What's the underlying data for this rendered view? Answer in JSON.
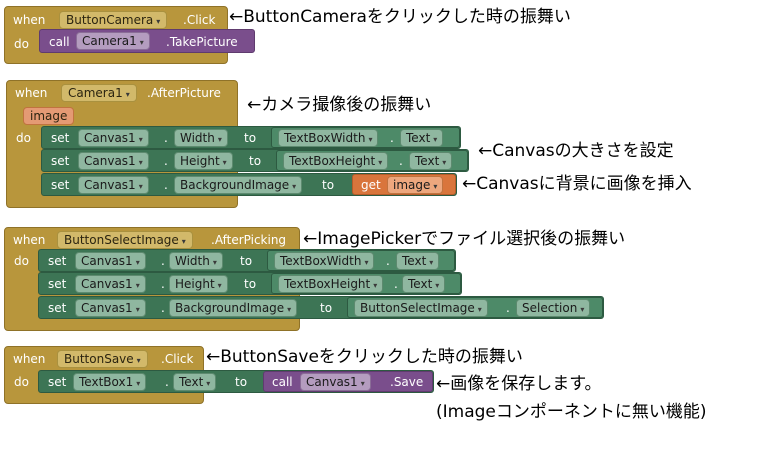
{
  "keywords": {
    "when": "when",
    "do": "do",
    "set": "set",
    "to": "to",
    "call": "call",
    "get": "get",
    "dot": "."
  },
  "caret": "▾",
  "block1": {
    "component": "ButtonCamera",
    "event": ".Click",
    "call_component": "Camera1",
    "call_method": ".TakePicture",
    "note": "←ButtonCameraをクリックした時の振舞い"
  },
  "block2": {
    "component": "Camera1",
    "event": ".AfterPicture",
    "param": "image",
    "note": "←カメラ撮像後の振舞い",
    "rows": [
      {
        "target": "Canvas1",
        "prop": "Width",
        "src": "TextBoxWidth",
        "src_prop": "Text",
        "note": "←Canvasの大きさを設定"
      },
      {
        "target": "Canvas1",
        "prop": "Height",
        "src": "TextBoxHeight",
        "src_prop": "Text"
      },
      {
        "target": "Canvas1",
        "prop": "BackgroundImage",
        "get_var": "image",
        "note": "←Canvasに背景に画像を挿入"
      }
    ]
  },
  "block3": {
    "component": "ButtonSelectImage",
    "event": ".AfterPicking",
    "note": "←ImagePickerでファイル選択後の振舞い",
    "rows": [
      {
        "target": "Canvas1",
        "prop": "Width",
        "src": "TextBoxWidth",
        "src_prop": "Text"
      },
      {
        "target": "Canvas1",
        "prop": "Height",
        "src": "TextBoxHeight",
        "src_prop": "Text"
      },
      {
        "target": "Canvas1",
        "prop": "BackgroundImage",
        "src": "ButtonSelectImage",
        "src_prop": "Selection"
      }
    ]
  },
  "block4": {
    "component": "ButtonSave",
    "event": ".Click",
    "target": "TextBox1",
    "prop": "Text",
    "call_component": "Canvas1",
    "call_method": ".Save",
    "note": "←ButtonSaveをクリックした時の振舞い",
    "note2": "←画像を保存します。",
    "note3": "(Imageコンポーネントに無い機能)"
  },
  "colors": {
    "event": "#b8963c",
    "call": "#7a4e8c",
    "set": "#3d7555",
    "get": "#d9753c"
  }
}
